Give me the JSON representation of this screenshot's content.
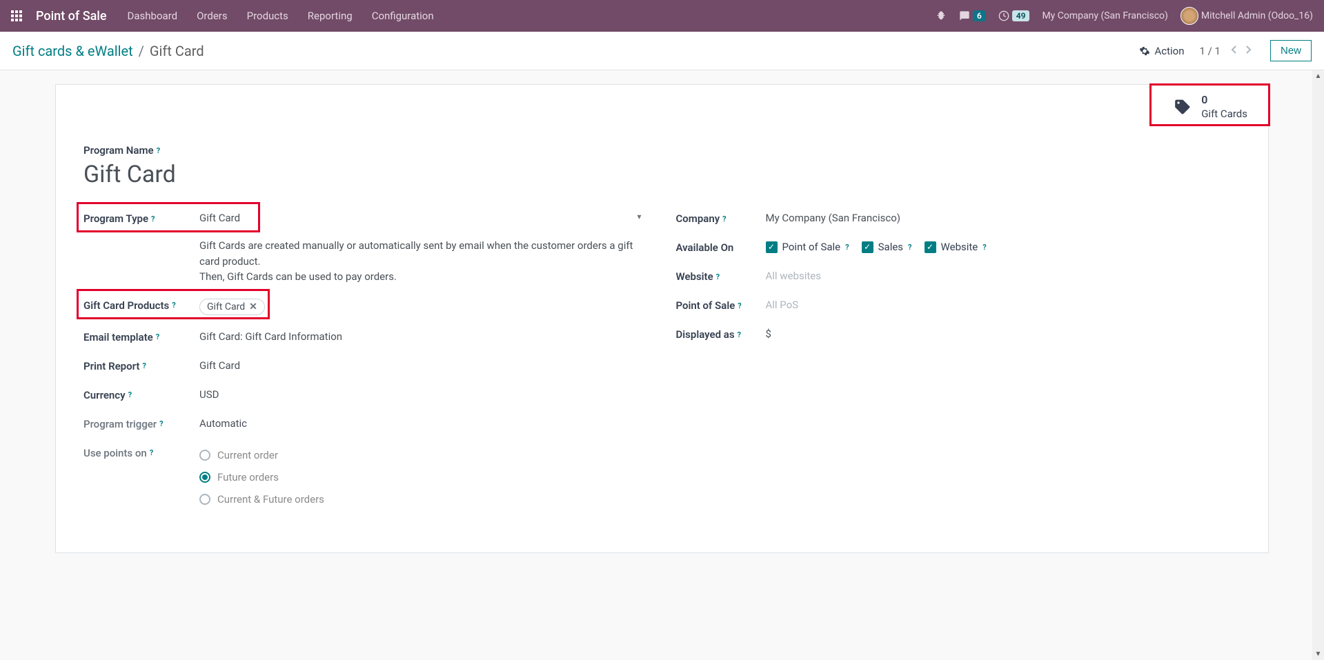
{
  "navbar": {
    "app_title": "Point of Sale",
    "menu": [
      "Dashboard",
      "Orders",
      "Products",
      "Reporting",
      "Configuration"
    ],
    "messages_count": "6",
    "activities_count": "49",
    "company": "My Company (San Francisco)",
    "user": "Mitchell Admin (Odoo_16)"
  },
  "breadcrumb": {
    "parent": "Gift cards & eWallet",
    "current": "Gift Card"
  },
  "controls": {
    "action_label": "Action",
    "pager": "1 / 1",
    "new_label": "New"
  },
  "stat_button": {
    "count": "0",
    "label": "Gift Cards"
  },
  "form": {
    "program_name_label": "Program Name",
    "program_name_value": "Gift Card",
    "left": {
      "program_type_label": "Program Type",
      "program_type_value": "Gift Card",
      "program_type_desc_line1": "Gift Cards are created manually or automatically sent by email when the customer orders a gift card product.",
      "program_type_desc_line2": "Then, Gift Cards can be used to pay orders.",
      "gift_card_products_label": "Gift Card Products",
      "gift_card_products_tag": "Gift Card",
      "email_template_label": "Email template",
      "email_template_value": "Gift Card: Gift Card Information",
      "print_report_label": "Print Report",
      "print_report_value": "Gift Card",
      "currency_label": "Currency",
      "currency_value": "USD",
      "program_trigger_label": "Program trigger",
      "program_trigger_value": "Automatic",
      "use_points_on_label": "Use points on",
      "radio_current": "Current order",
      "radio_future": "Future orders",
      "radio_both": "Current & Future orders"
    },
    "right": {
      "company_label": "Company",
      "company_value": "My Company (San Francisco)",
      "available_on_label": "Available On",
      "available_on_pos": "Point of Sale",
      "available_on_sales": "Sales",
      "available_on_website": "Website",
      "website_label": "Website",
      "website_value": "All websites",
      "pos_label": "Point of Sale",
      "pos_value": "All PoS",
      "displayed_as_label": "Displayed as",
      "displayed_as_value": "$"
    }
  }
}
